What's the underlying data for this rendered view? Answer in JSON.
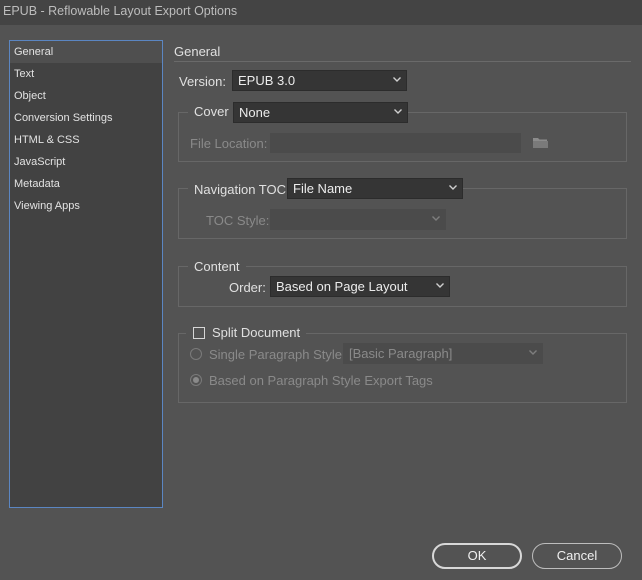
{
  "window": {
    "title": "EPUB - Reflowable Layout Export Options"
  },
  "sidebar": {
    "items": [
      {
        "label": "General",
        "selected": true
      },
      {
        "label": "Text"
      },
      {
        "label": "Object"
      },
      {
        "label": "Conversion Settings"
      },
      {
        "label": "HTML & CSS"
      },
      {
        "label": "JavaScript"
      },
      {
        "label": "Metadata"
      },
      {
        "label": "Viewing Apps"
      }
    ]
  },
  "general": {
    "section_title": "General",
    "version": {
      "label": "Version:",
      "value": "EPUB 3.0"
    },
    "cover": {
      "label": "Cover",
      "value": "None",
      "file_location_label": "File Location:",
      "file_location_value": ""
    },
    "navigation": {
      "label": "Navigation TOC",
      "value": "File Name",
      "toc_style_label": "TOC Style:",
      "toc_style_value": ""
    },
    "content": {
      "label": "Content",
      "order_label": "Order:",
      "order_value": "Based on Page Layout"
    },
    "split": {
      "checkbox_label": "Split Document",
      "checked": false,
      "single_paragraph_label": "Single Paragraph Style",
      "single_paragraph_value": "[Basic Paragraph]",
      "export_tags_label": "Based on Paragraph Style Export Tags"
    }
  },
  "footer": {
    "ok_label": "OK",
    "cancel_label": "Cancel"
  },
  "icons": {
    "folder": "folder-icon",
    "chevron": "chevron-down-icon"
  }
}
